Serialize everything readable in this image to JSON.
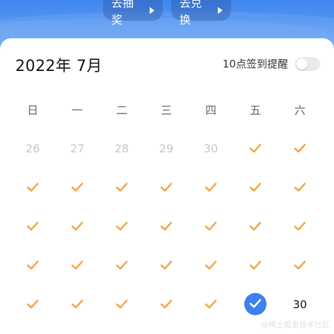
{
  "header": {
    "lottery_label": "去抽奖",
    "exchange_label": "去兑换"
  },
  "calendar": {
    "month_title": "2022年 7月",
    "remind_label": "10点签到提醒",
    "remind_enabled": false,
    "weekdays": [
      "日",
      "一",
      "二",
      "三",
      "四",
      "五",
      "六"
    ],
    "days": [
      {
        "label": "26",
        "type": "outside"
      },
      {
        "label": "27",
        "type": "outside"
      },
      {
        "label": "28",
        "type": "outside"
      },
      {
        "label": "29",
        "type": "outside"
      },
      {
        "label": "30",
        "type": "outside"
      },
      {
        "label": "",
        "type": "checked"
      },
      {
        "label": "",
        "type": "checked"
      },
      {
        "label": "",
        "type": "checked"
      },
      {
        "label": "",
        "type": "checked"
      },
      {
        "label": "",
        "type": "checked"
      },
      {
        "label": "",
        "type": "checked"
      },
      {
        "label": "",
        "type": "checked"
      },
      {
        "label": "",
        "type": "checked"
      },
      {
        "label": "",
        "type": "checked"
      },
      {
        "label": "",
        "type": "checked"
      },
      {
        "label": "",
        "type": "checked"
      },
      {
        "label": "",
        "type": "checked"
      },
      {
        "label": "",
        "type": "checked"
      },
      {
        "label": "",
        "type": "checked"
      },
      {
        "label": "",
        "type": "checked"
      },
      {
        "label": "",
        "type": "checked"
      },
      {
        "label": "",
        "type": "checked"
      },
      {
        "label": "",
        "type": "checked"
      },
      {
        "label": "",
        "type": "checked"
      },
      {
        "label": "",
        "type": "checked"
      },
      {
        "label": "",
        "type": "checked"
      },
      {
        "label": "",
        "type": "checked"
      },
      {
        "label": "",
        "type": "checked"
      },
      {
        "label": "",
        "type": "checked"
      },
      {
        "label": "",
        "type": "checked"
      },
      {
        "label": "",
        "type": "checked"
      },
      {
        "label": "",
        "type": "checked"
      },
      {
        "label": "",
        "type": "checked"
      },
      {
        "label": "",
        "type": "selected"
      },
      {
        "label": "30",
        "type": "normal"
      }
    ]
  },
  "colors": {
    "accent_blue": "#3d80ef",
    "check_orange": "#f3a64a",
    "muted_text": "#c6c6c6"
  },
  "watermark": "@稀土掘金技术社区"
}
